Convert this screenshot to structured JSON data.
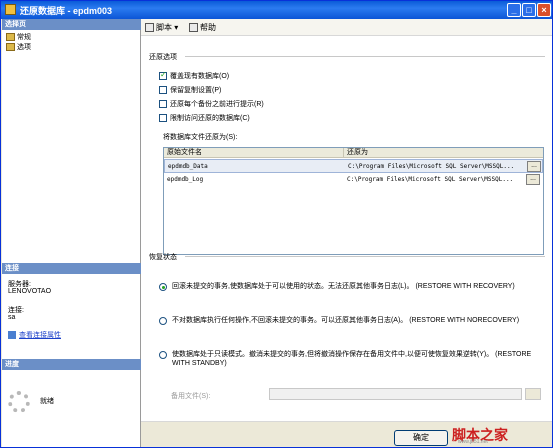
{
  "window": {
    "title": "还原数据库 - epdm003"
  },
  "left": {
    "select_page_header": "选择页",
    "pages": [
      "常规",
      "选项"
    ],
    "connection_header": "连接",
    "server_label": "服务器:",
    "server_value": "LENOVOTAO",
    "connection_label": "连接:",
    "connection_value": "sa",
    "view_props_link": "查看连接属性",
    "progress_header": "进度",
    "progress_status": "就绪"
  },
  "toolbar": {
    "script": "脚本",
    "help": "帮助"
  },
  "restore_options": {
    "title": "还原选项",
    "options": [
      {
        "label": "覆盖现有数据库(O)",
        "checked": true
      },
      {
        "label": "保留复制设置(P)",
        "checked": false
      },
      {
        "label": "还原每个备份之前进行提示(R)",
        "checked": false
      },
      {
        "label": "限制访问还原的数据库(C)",
        "checked": false
      }
    ],
    "restore_as_label": "将数据库文件还原为(S):",
    "grid": {
      "headers": [
        "原始文件名",
        "还原为"
      ],
      "rows": [
        {
          "orig": "epdmdb_Data",
          "restore": "C:\\Program Files\\Microsoft SQL Server\\MSSQL...",
          "btn": "..."
        },
        {
          "orig": "epdmdb_Log",
          "restore": "C:\\Program Files\\Microsoft SQL Server\\MSSQL...",
          "btn": "..."
        }
      ]
    }
  },
  "recovery_state": {
    "title": "恢复状态",
    "options": [
      {
        "label": "回滚未提交的事务,使数据库处于可以使用的状态。无法还原其他事务日志(L)。 (RESTORE WITH RECOVERY)",
        "selected": true
      },
      {
        "label": "不对数据库执行任何操作,不回滚未提交的事务。可以还原其他事务日志(A)。 (RESTORE WITH NORECOVERY)",
        "selected": false
      },
      {
        "label": "使数据库处于只读模式。撤消未提交的事务,但将撤消操作保存在备用文件中,以便可使恢复效果逆转(Y)。 (RESTORE WITH STANDBY)",
        "selected": false
      }
    ],
    "standby_file_label": "备用文件(S):"
  },
  "bottom": {
    "ok_label": "确定",
    "watermark_main": "脚本之家",
    "watermark_sub": "www.jb51.net"
  }
}
